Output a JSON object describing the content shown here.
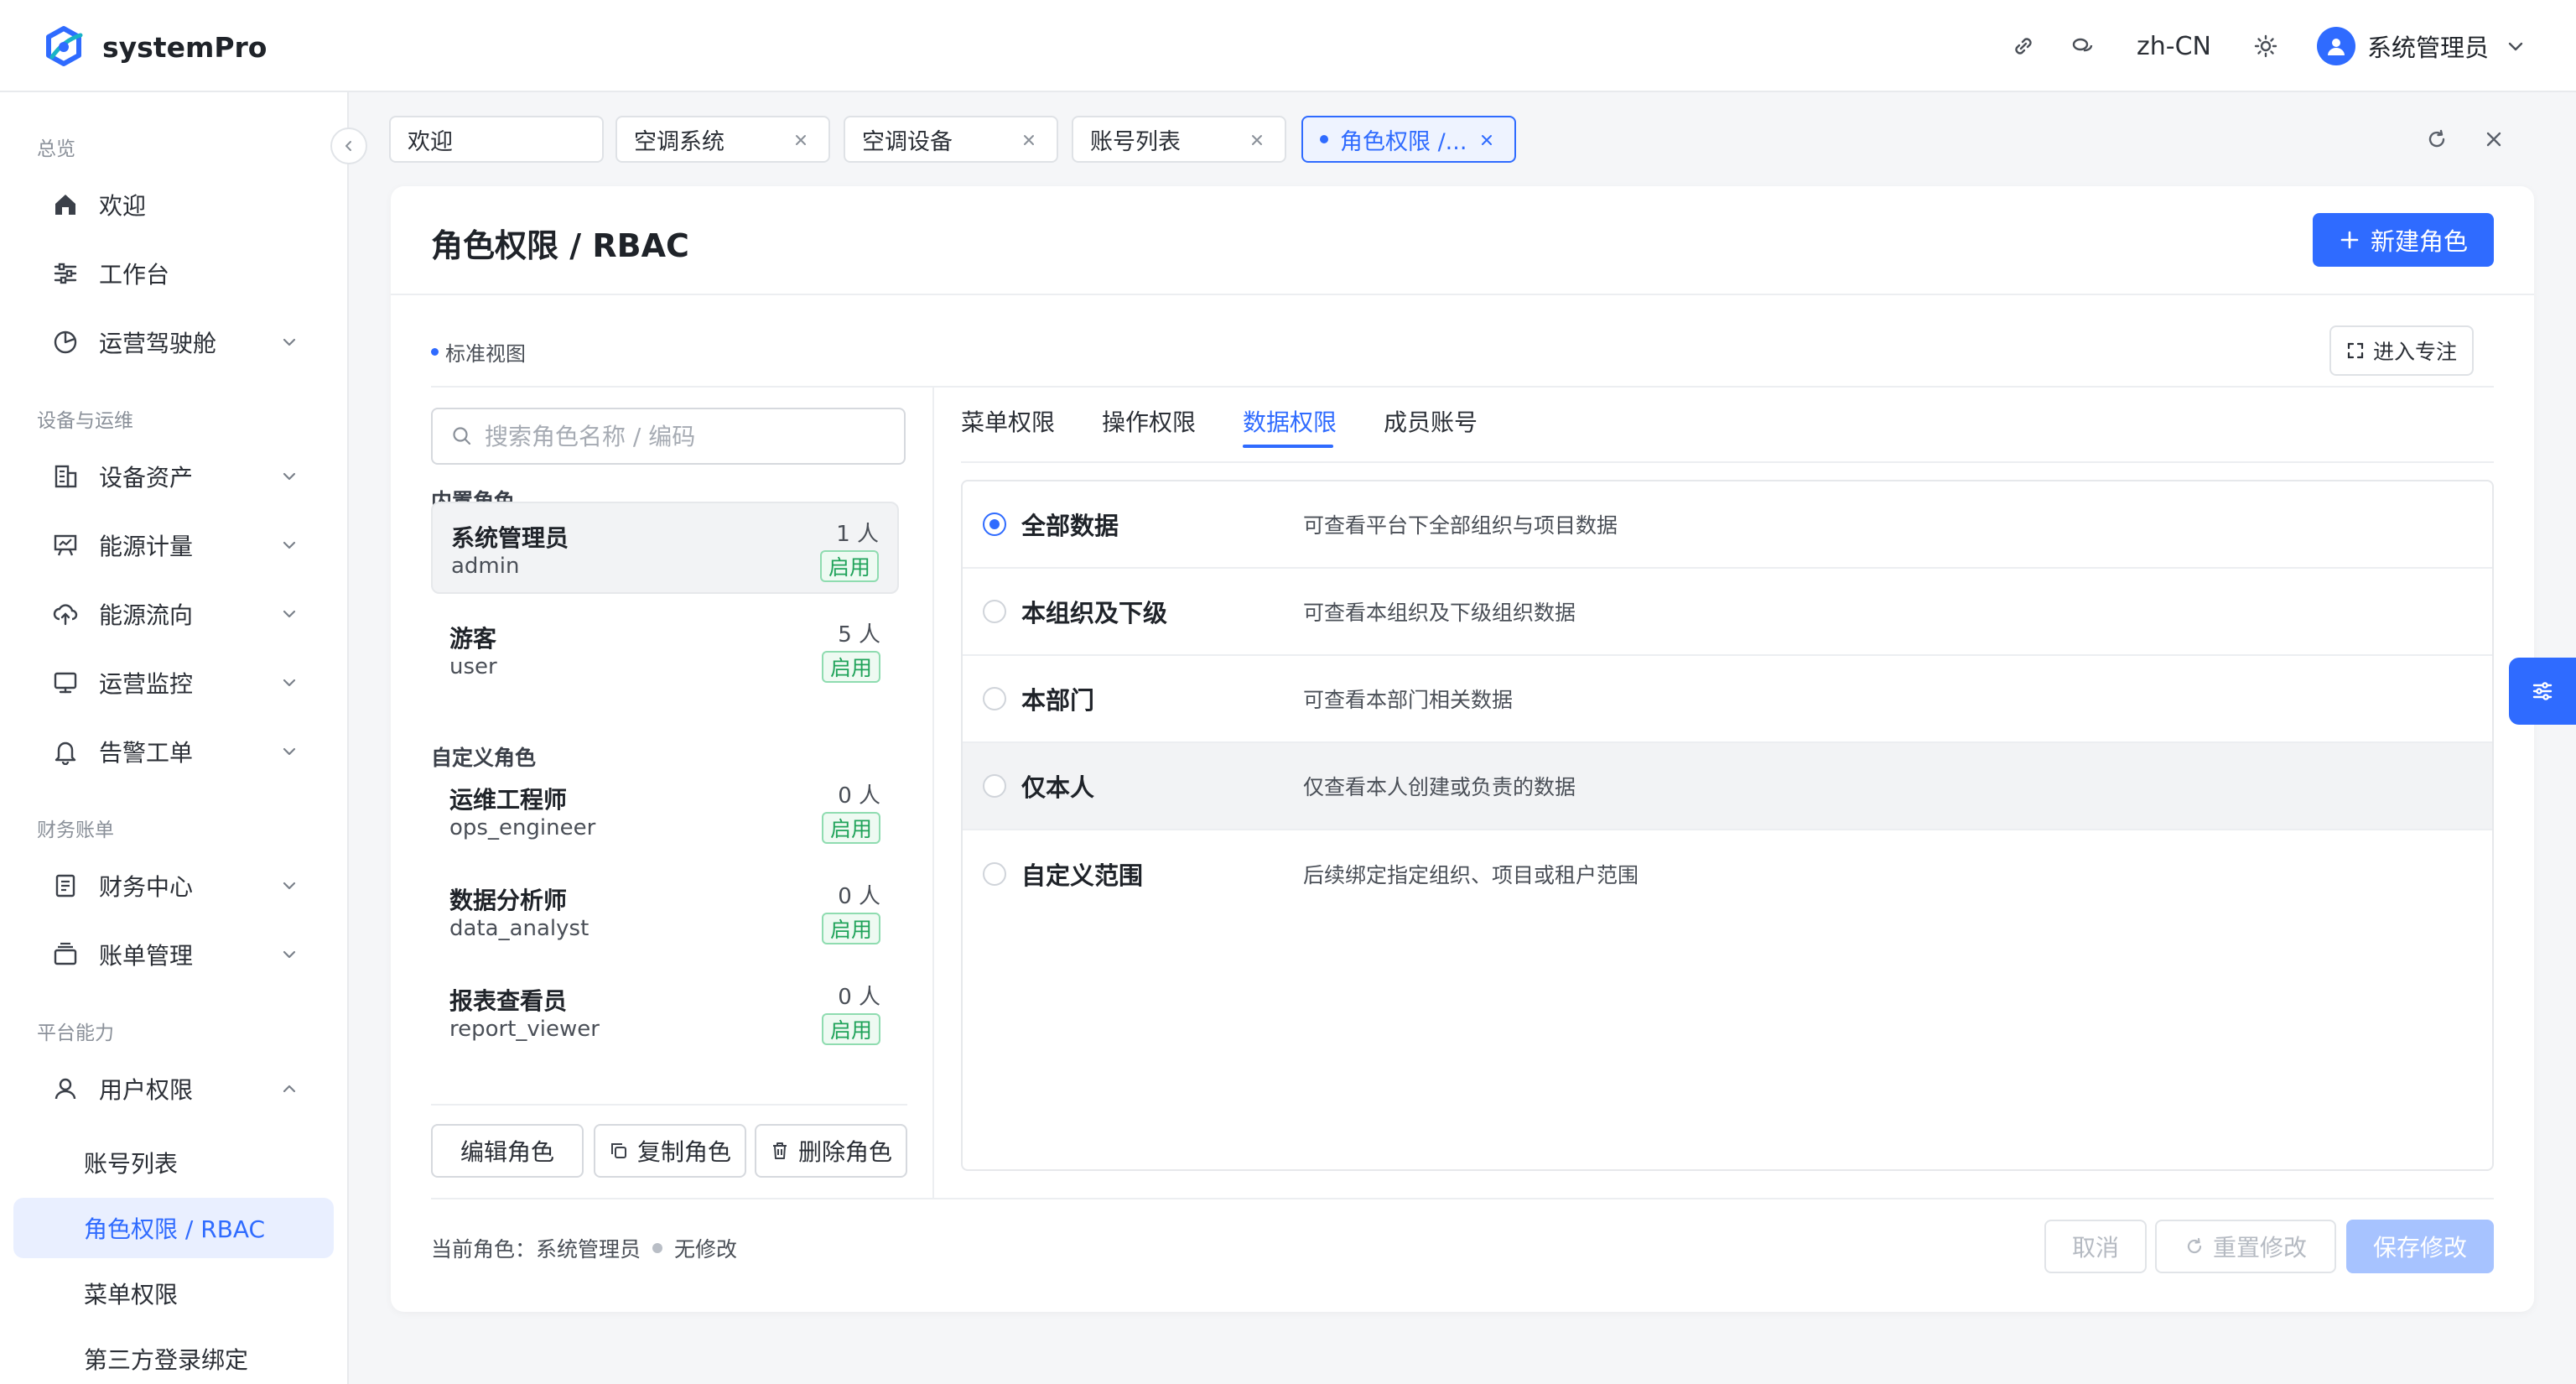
{
  "app": {
    "name": "systemPro"
  },
  "header": {
    "language": "zh-CN",
    "user_name": "系统管理员"
  },
  "sidebar": {
    "groups": [
      {
        "title": "总览",
        "items": [
          {
            "label": "欢迎",
            "icon": "home-icon"
          },
          {
            "label": "工作台",
            "icon": "sliders-icon"
          },
          {
            "label": "运营驾驶舱",
            "icon": "pie-chart-icon"
          }
        ]
      },
      {
        "title": "设备与运维",
        "items": [
          {
            "label": "设备资产",
            "icon": "building-icon"
          },
          {
            "label": "能源计量",
            "icon": "presentation-icon"
          },
          {
            "label": "能源流向",
            "icon": "cloud-upload-icon"
          },
          {
            "label": "运营监控",
            "icon": "monitor-icon"
          },
          {
            "label": "告警工单",
            "icon": "bell-icon"
          }
        ]
      },
      {
        "title": "财务账单",
        "items": [
          {
            "label": "财务中心",
            "icon": "document-icon"
          },
          {
            "label": "账单管理",
            "icon": "wallet-icon"
          }
        ]
      },
      {
        "title": "平台能力",
        "items": [
          {
            "label": "用户权限",
            "icon": "user-icon"
          }
        ]
      }
    ],
    "sub_items": [
      {
        "label": "账号列表"
      },
      {
        "label": "角色权限 / RBAC",
        "active": true
      },
      {
        "label": "菜单权限"
      },
      {
        "label": "第三方登录绑定"
      }
    ]
  },
  "tabs": [
    {
      "label": "欢迎"
    },
    {
      "label": "空调系统"
    },
    {
      "label": "空调设备"
    },
    {
      "label": "账号列表"
    },
    {
      "label": "角色权限 /...",
      "active": true
    }
  ],
  "page": {
    "title": "角色权限 / RBAC",
    "new_role_label": "新建角色",
    "view_label": "标准视图",
    "focus_label": "进入专注"
  },
  "roles": {
    "search_placeholder": "搜索角色名称 / 编码",
    "builtin_title": "内置角色",
    "custom_title": "自定义角色",
    "builtin": [
      {
        "name": "系统管理员",
        "code": "admin",
        "count": "1 人",
        "status": "启用",
        "selected": true
      },
      {
        "name": "游客",
        "code": "user",
        "count": "5 人",
        "status": "启用"
      }
    ],
    "custom": [
      {
        "name": "运维工程师",
        "code": "ops_engineer",
        "count": "0 人",
        "status": "启用"
      },
      {
        "name": "数据分析师",
        "code": "data_analyst",
        "count": "0 人",
        "status": "启用"
      },
      {
        "name": "报表查看员",
        "code": "report_viewer",
        "count": "0 人",
        "status": "启用"
      }
    ],
    "actions": {
      "edit": "编辑角色",
      "copy": "复制角色",
      "delete": "删除角色"
    }
  },
  "permission_tabs": [
    {
      "label": "菜单权限"
    },
    {
      "label": "操作权限"
    },
    {
      "label": "数据权限",
      "active": true
    },
    {
      "label": "成员账号"
    }
  ],
  "data_scopes": [
    {
      "name": "全部数据",
      "desc": "可查看平台下全部组织与项目数据",
      "selected": true
    },
    {
      "name": "本组织及下级",
      "desc": "可查看本组织及下级组织数据"
    },
    {
      "name": "本部门",
      "desc": "可查看本部门相关数据"
    },
    {
      "name": "仅本人",
      "desc": "仅查看本人创建或负责的数据"
    },
    {
      "name": "自定义范围",
      "desc": "后续绑定指定组织、项目或租户范围"
    }
  ],
  "footer": {
    "current_role_label": "当前角色：系统管理员",
    "change_status": "无修改",
    "cancel": "取消",
    "reset": "重置修改",
    "save": "保存修改"
  },
  "colors": {
    "primary": "#2f6bff",
    "success": "#20a35a",
    "active_bg": "#e9efff"
  }
}
